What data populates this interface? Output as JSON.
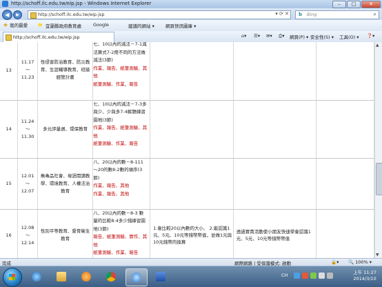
{
  "window": {
    "title": "http://schoff.ilc.edu.tw/eip.jsp - Windows Internet Explorer"
  },
  "address": {
    "url": "http://schoff.ilc.edu.tw/eip.jsp"
  },
  "search": {
    "engine": "Bing"
  },
  "favorites": {
    "label": "我的最愛",
    "items": [
      "宜蘭縣政府教育處",
      "Google",
      "建議的網站 ▾",
      "網頁快訊圖庫 ▾"
    ]
  },
  "tab": {
    "label": "http://schoff.ilc.edu.tw/eip.jsp"
  },
  "commands": [
    "網頁(P) ▾",
    "安全性(S) ▾",
    "工具(O) ▾",
    "❓▾"
  ],
  "rows": [
    {
      "num": "13",
      "d1": "11.17",
      "d2": "～",
      "d3": "11.23",
      "topic": "性侵害防治教育、防災教育、生涯輔導教育、班級經營計畫",
      "obj": [
        {
          "t": "七、10以內的減法－7-1減",
          "red": false
        },
        {
          "t": "法算式7-2用不同的方法做",
          "red": false
        },
        {
          "t": "減法(3節)",
          "red": false
        },
        {
          "t": "作業、報告、紙筆測驗、其",
          "red": true
        },
        {
          "t": "他",
          "red": true
        },
        {
          "t": "紙筆測驗、作業、報告",
          "red": true
        }
      ],
      "c5": "",
      "c6": ""
    },
    {
      "num": "14",
      "d1": "11.24",
      "d2": "～",
      "d3": "11.30",
      "topic": "多元評量週、環保教育",
      "obj": [
        {
          "t": "七、10以內的減法－7-3多",
          "red": false
        },
        {
          "t": "與少、少與多7-4解題練習",
          "red": false
        },
        {
          "t": "園地(3節)",
          "red": false
        },
        {
          "t": "作業、報告、紙筆測驗、其",
          "red": true
        },
        {
          "t": "他",
          "red": true
        },
        {
          "t": "紙筆測驗、作業、報告",
          "red": true
        }
      ],
      "c5": "",
      "c6": ""
    },
    {
      "num": "15",
      "d1": "12.01",
      "d2": "～",
      "d3": "12.07",
      "topic": "無毒品社會、母語閱讀教學、環境教育、人權法治教育",
      "obj": [
        {
          "t": "八、20以內的數－8-111",
          "red": false
        },
        {
          "t": "～20的數8-2數的順序(3",
          "red": false
        },
        {
          "t": "節)",
          "red": false
        },
        {
          "t": "作業、報告、其他",
          "red": true
        },
        {
          "t": "作業、報告、其他",
          "red": true
        }
      ],
      "c5": "",
      "c6": ""
    },
    {
      "num": "16",
      "d1": "12.08",
      "d2": "～",
      "d3": "12.14",
      "topic": "性別平等教育、愛育衛生教育",
      "obj": [
        {
          "t": "八、20以內的數－8-3 數",
          "red": false
        },
        {
          "t": "量的比較8-4多少錢練習園",
          "red": false
        },
        {
          "t": "地(3節)",
          "red": false
        },
        {
          "t": "報告、紙筆測驗、實作、其",
          "red": true
        },
        {
          "t": "他",
          "red": true
        },
        {
          "t": "紙筆測驗、作業、報告",
          "red": true
        }
      ],
      "c5": "1.會比較20以內數的大小、 2.能認識1元、5元、10元等錢幣幣值，並做1元與10元錢幣的換算",
      "c6": "透過實責活動使小朋友快速學會認識1元、5元、10元等錢幣幣值"
    },
    {
      "num": "",
      "d1": "",
      "d2": "",
      "d3": "",
      "topic": "",
      "obj": [
        {
          "t": "九、加減法－9-1多題第",
          "red": false
        }
      ],
      "c5": "",
      "c6": ""
    }
  ],
  "status": {
    "left": "完成",
    "zone": "網際網路 | 受保護模式: 啟動",
    "zoom": "🔍 100% ▾"
  },
  "taskbar": {
    "time": "上午 11:27",
    "date": "2014/3/10",
    "lang": "CH"
  }
}
